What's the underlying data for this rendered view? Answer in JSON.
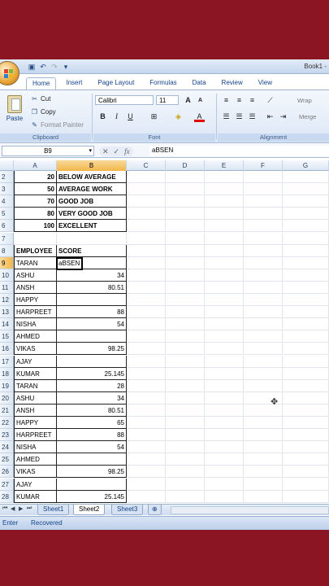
{
  "window": {
    "title": "Book1 -"
  },
  "ribbon": {
    "tabs": [
      "Home",
      "Insert",
      "Page Layout",
      "Formulas",
      "Data",
      "Review",
      "View"
    ],
    "clipboard": {
      "paste": "Paste",
      "cut": "Cut",
      "copy": "Copy",
      "format_painter": "Format Painter",
      "label": "Clipboard"
    },
    "font": {
      "name": "Calibri",
      "size": "11",
      "label": "Font",
      "bold": "B",
      "italic": "I",
      "underline": "U"
    },
    "alignment": {
      "wrap": "Wrap",
      "merge": "Merge",
      "label": "Alignment"
    }
  },
  "formula_bar": {
    "name_box": "B9",
    "fx": "fx",
    "content": "aBSEN"
  },
  "columns": [
    "A",
    "B",
    "C",
    "D",
    "E",
    "F",
    "G"
  ],
  "rows": [
    {
      "n": "2",
      "a": "20",
      "b": "BELOW AVERAGE"
    },
    {
      "n": "3",
      "a": "50",
      "b": "AVERAGE WORK"
    },
    {
      "n": "4",
      "a": "70",
      "b": "GOOD JOB"
    },
    {
      "n": "5",
      "a": "80",
      "b": "VERY GOOD JOB"
    },
    {
      "n": "6",
      "a": "100",
      "b": "EXCELLENT"
    },
    {
      "n": "7",
      "a": "",
      "b": ""
    },
    {
      "n": "8",
      "a": "EMPLOYEE",
      "b": "SCORE"
    },
    {
      "n": "9",
      "a": "TARAN",
      "b": "aBSEN"
    },
    {
      "n": "10",
      "a": "ASHU",
      "b": "34"
    },
    {
      "n": "11",
      "a": "ANSH",
      "b": "80.51"
    },
    {
      "n": "12",
      "a": "HAPPY",
      "b": ""
    },
    {
      "n": "13",
      "a": "HARPREET",
      "b": "88"
    },
    {
      "n": "14",
      "a": "NISHA",
      "b": "54"
    },
    {
      "n": "15",
      "a": "AHMED",
      "b": ""
    },
    {
      "n": "16",
      "a": "VIKAS",
      "b": "98.25"
    },
    {
      "n": "17",
      "a": "AJAY",
      "b": ""
    },
    {
      "n": "18",
      "a": "KUMAR",
      "b": "25.145"
    },
    {
      "n": "19",
      "a": "TARAN",
      "b": "28"
    },
    {
      "n": "20",
      "a": "ASHU",
      "b": "34"
    },
    {
      "n": "21",
      "a": "ANSH",
      "b": "80.51"
    },
    {
      "n": "22",
      "a": "HAPPY",
      "b": "65"
    },
    {
      "n": "23",
      "a": "HARPREET",
      "b": "88"
    },
    {
      "n": "24",
      "a": "NISHA",
      "b": "54"
    },
    {
      "n": "25",
      "a": "AHMED",
      "b": ""
    },
    {
      "n": "26",
      "a": "VIKAS",
      "b": "98.25"
    },
    {
      "n": "27",
      "a": "AJAY",
      "b": ""
    },
    {
      "n": "28",
      "a": "KUMAR",
      "b": "25.145"
    }
  ],
  "sheets": [
    "Sheet1",
    "Sheet2",
    "Sheet3"
  ],
  "status": {
    "mode": "Enter",
    "recovered": "Recovered"
  },
  "colors": {
    "accent": "#15428b",
    "selection": "#f1b64a",
    "background": "#8c1523"
  }
}
